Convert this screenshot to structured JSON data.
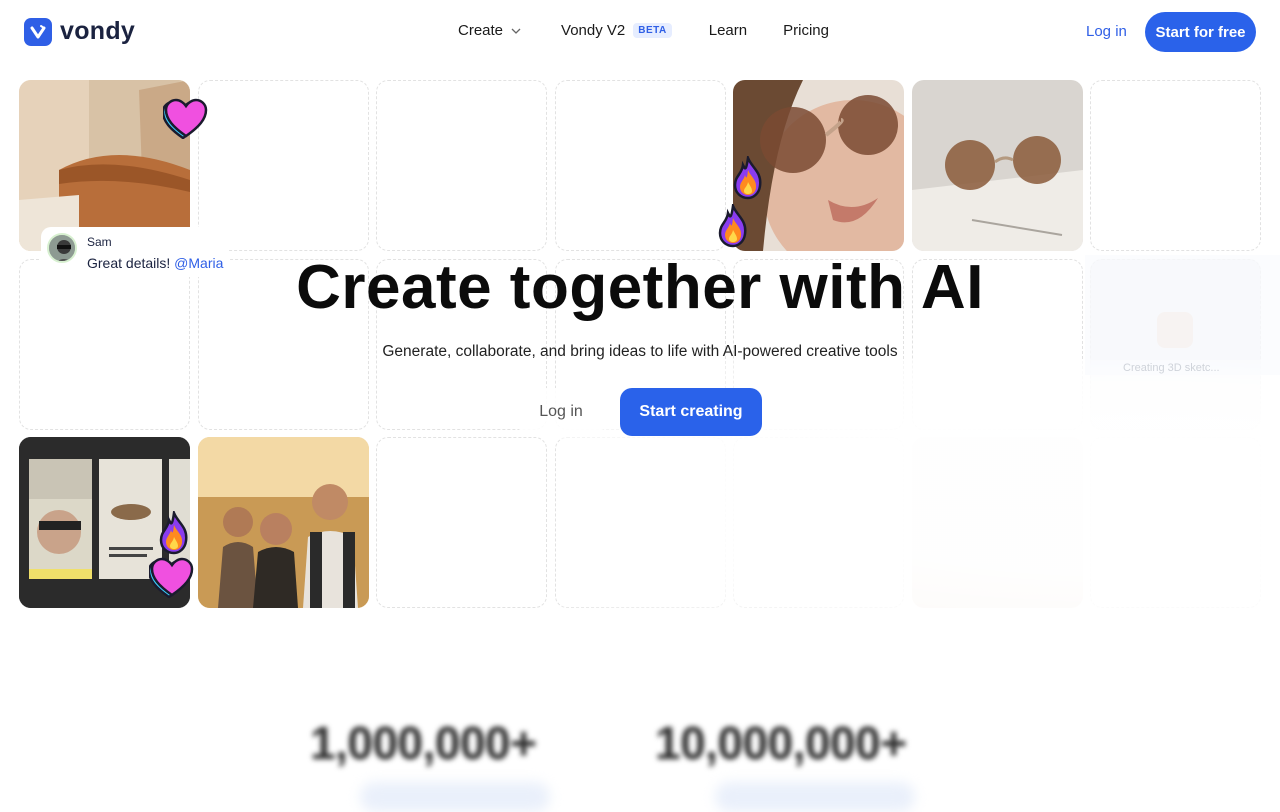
{
  "nav": {
    "logo_text": "vondy",
    "links": {
      "create": "Create",
      "v2": "Vondy V2",
      "beta": "BETA",
      "learn": "Learn",
      "pricing": "Pricing"
    },
    "login": "Log in",
    "cta": "Start for free"
  },
  "comment": {
    "name": "Sam",
    "message": "Great details!",
    "mention": "@Maria"
  },
  "hero": {
    "title": "Create together with AI",
    "subtitle": "Generate, collaborate, and bring ideas to life with AI-powered creative tools",
    "login": "Log in",
    "cta": "Start creating"
  },
  "generating_text": "Creating 3D sketc...",
  "stats": {
    "first": "1,000,000+",
    "second": "10,000,000+"
  },
  "colors": {
    "accent": "#2a62ea",
    "heart": "#f050e0",
    "fire": "#ff8a1f"
  }
}
